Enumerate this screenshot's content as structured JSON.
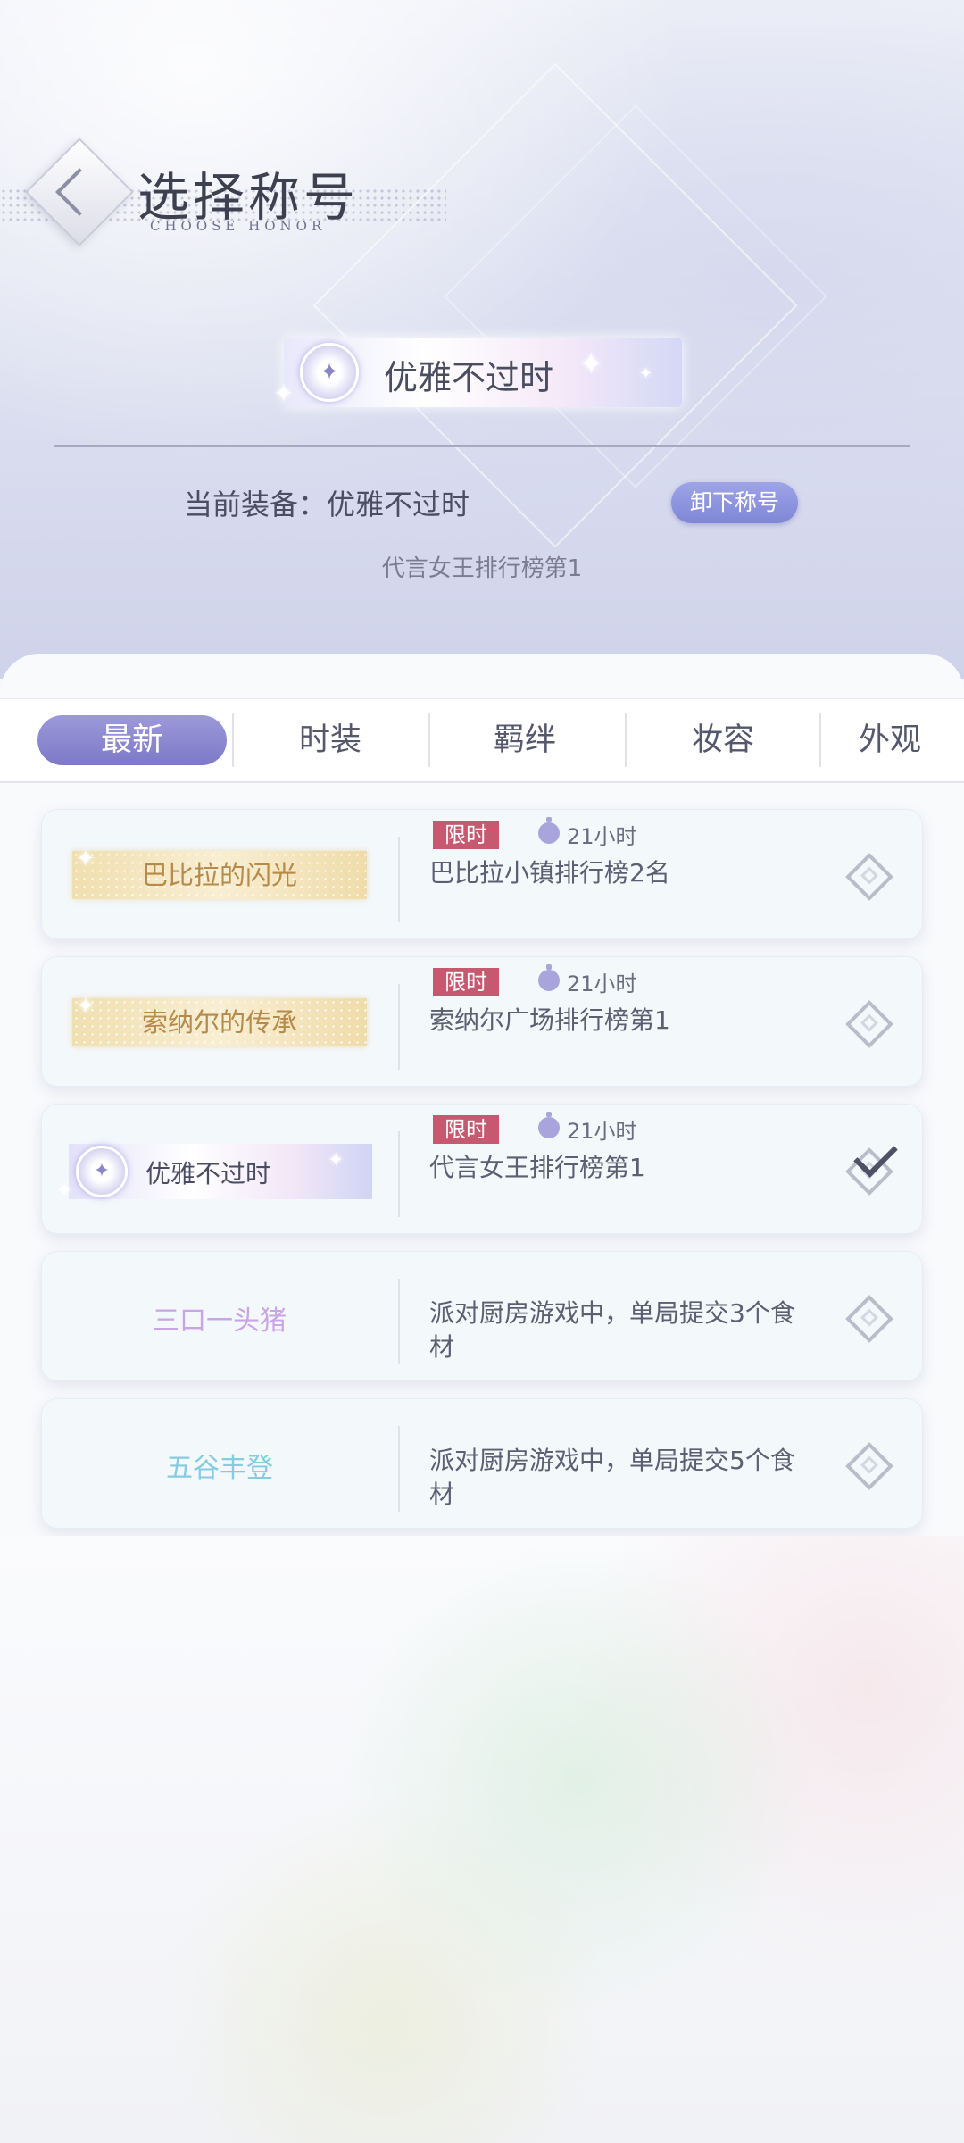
{
  "header": {
    "title": "选择称号",
    "subtitle": "CHOOSE HONOR"
  },
  "current": {
    "badge_text": "优雅不过时",
    "equipped_label": "当前装备：优雅不过时",
    "unequip_button": "卸下称号",
    "description": "代言女王排行榜第1"
  },
  "tabs": [
    {
      "label": "最新",
      "active": true
    },
    {
      "label": "时装",
      "active": false
    },
    {
      "label": "羁绊",
      "active": false
    },
    {
      "label": "妆容",
      "active": false
    },
    {
      "label": "外观",
      "active": false
    }
  ],
  "list": [
    {
      "name": "巴比拉的闪光",
      "style": "gold",
      "limited_tag": "限时",
      "timer": "21小时",
      "condition": "巴比拉小镇排行榜2名",
      "equipped": false
    },
    {
      "name": "索纳尔的传承",
      "style": "gold",
      "limited_tag": "限时",
      "timer": "21小时",
      "condition": "索纳尔广场排行榜第1",
      "equipped": false
    },
    {
      "name": "优雅不过时",
      "style": "purple",
      "limited_tag": "限时",
      "timer": "21小时",
      "condition": "代言女王排行榜第1",
      "equipped": true
    },
    {
      "name": "三口一头猪",
      "style": "text",
      "name_color": "#c9a4e6",
      "condition": "派对厨房游戏中，单局提交3个食材",
      "equipped": false
    },
    {
      "name": "五谷丰登",
      "style": "text",
      "name_color": "#86cbe0",
      "condition": "派对厨房游戏中，单局提交5个食材",
      "equipped": false
    }
  ],
  "icons": {
    "back": "back-diamond-icon",
    "timer": "stopwatch-icon",
    "select": "diamond-select-icon",
    "check": "check-icon"
  }
}
